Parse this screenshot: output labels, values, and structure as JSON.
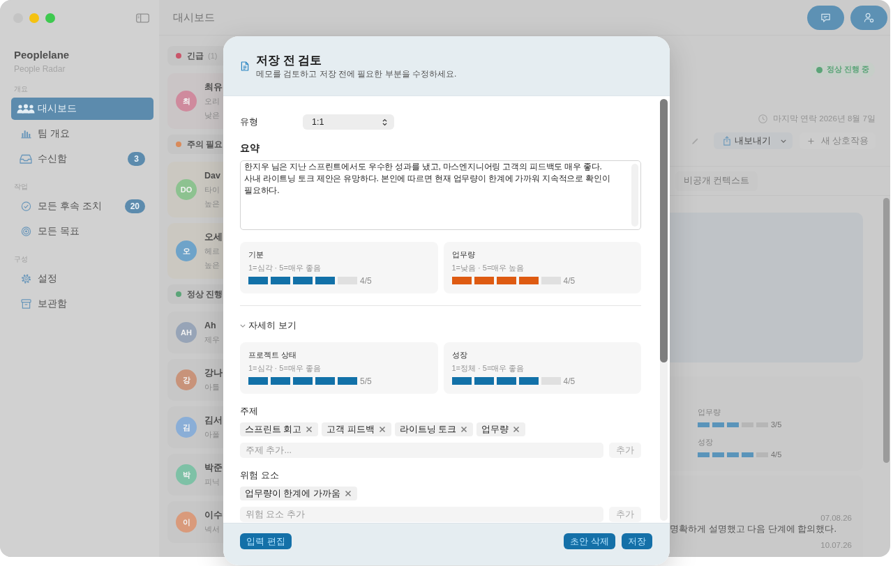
{
  "window": {
    "title": "대시보드",
    "close_button_disabled": true
  },
  "sidebar": {
    "app_name": "Peoplelane",
    "app_subtitle": "People Radar",
    "sections": [
      {
        "title": "개요",
        "items": [
          {
            "label": "대시보드",
            "selected": true
          },
          {
            "label": "팀 개요",
            "selected": false
          },
          {
            "label": "수신함",
            "badge": "3",
            "selected": false
          }
        ]
      },
      {
        "title": "작업",
        "items": [
          {
            "label": "모든 후속 조치",
            "badge": "20",
            "selected": false
          },
          {
            "label": "모든 목표",
            "selected": false
          }
        ]
      },
      {
        "title": "구성",
        "items": [
          {
            "label": "설정",
            "selected": false
          },
          {
            "label": "보관함",
            "selected": false
          }
        ]
      }
    ]
  },
  "people_list": {
    "groups": [
      {
        "title": "긴급",
        "count": "(1)",
        "color": "#c9566a",
        "people": [
          {
            "initials": "최",
            "color": "#cf8a9d",
            "name": "최유",
            "lines": [
              "오리",
              "낮은"
            ]
          }
        ]
      },
      {
        "title": "주의 필요",
        "color": "#d98b5b",
        "people": [
          {
            "initials": "DO",
            "color": "#8dc290",
            "name": "Dav",
            "lines": [
              "타이",
              "높은"
            ]
          },
          {
            "initials": "오",
            "color": "#6ea3c9",
            "name": "오세",
            "lines": [
              "헤르",
              "높은"
            ]
          }
        ]
      },
      {
        "title": "정상 진행",
        "color": "#5ba478",
        "people": [
          {
            "initials": "AH",
            "color": "#97a4b7",
            "name": "Ah",
            "lines": [
              "제우"
            ]
          },
          {
            "initials": "강",
            "color": "#c8937a",
            "name": "강나",
            "lines": [
              "아틀"
            ]
          },
          {
            "initials": "김",
            "color": "#8aaed7",
            "name": "김서",
            "lines": [
              "아폴"
            ]
          },
          {
            "initials": "박",
            "color": "#7ec1a6",
            "name": "박준",
            "lines": [
              "피닉"
            ]
          },
          {
            "initials": "이",
            "color": "#d99a7b",
            "name": "이수",
            "lines": [
              "넥서"
            ]
          }
        ]
      }
    ]
  },
  "detail": {
    "status": {
      "label": "정상 진행 중",
      "color": "#5ba478"
    },
    "last_contact": "마지막 연락 2026년 8월 7일",
    "toolbar": {
      "export_label": "내보내기",
      "new_label": "새 상호작용",
      "new_disabled": true
    },
    "tabs": [
      {
        "label": "비공개 컨텍스트",
        "selected": false
      }
    ],
    "ratings": [
      {
        "label": "업무량",
        "level": 0.6,
        "reading": "3/5"
      },
      {
        "label": "성장",
        "level": 0.8,
        "reading": "4/5"
      }
    ],
    "notes": [
      {
        "date": "07.08.26",
        "text": "명확하게 설명했고 다음 단계에 합의했다."
      },
      {
        "date": "10.07.26"
      }
    ]
  },
  "review_dialog": {
    "title": "저장 전 검토",
    "subtitle": "메모를 검토하고 저장 전에 필요한 부분을 수정하세요.",
    "type": {
      "label": "유형",
      "value": "1:1"
    },
    "summary": {
      "label": "요약",
      "value": "한지우 님은 지난 스프린트에서도 우수한 성과를 냈고, 마스엔지니어링 고객의 피드백도 매우 좋다. 사내 라이트닝 토크 제안은 유망하다. 본인에 따르면 현재 업무량이 한계에 가까워 지속적으로 확인이 필요하다."
    },
    "ratings": [
      {
        "label": "기분",
        "hint": "1=심각 · 5=매우 좋음",
        "level": 0.8,
        "reading": "4/5",
        "color": "#1271a8"
      },
      {
        "label": "업무량",
        "hint": "1=낮음 · 5=매우 높음",
        "level": 0.8,
        "reading": "4/5",
        "color": "#de5b12"
      }
    ],
    "details": {
      "label": "자세히 보기",
      "expanded": true,
      "ratings": [
        {
          "label": "프로젝트 상태",
          "hint": "1=심각 · 5=매우 좋음",
          "level": 1,
          "reading": "5/5",
          "color": "#1271a8"
        },
        {
          "label": "성장",
          "hint": "1=정체 · 5=매우 좋음",
          "level": 0.8,
          "reading": "4/5",
          "color": "#1271a8"
        }
      ]
    },
    "topics": {
      "label": "주제",
      "tags": [
        "스프린트 회고",
        "고객 피드백",
        "라이트닝 토크",
        "업무량"
      ],
      "placeholder": "주제 추가...",
      "add_button": {
        "label": "추가",
        "disabled": true
      }
    },
    "risks": {
      "label": "위험 요소",
      "tags": [
        "업무량이 한계에 가까움"
      ],
      "placeholder": "위험 요소 추가",
      "add_button": {
        "label": "추가",
        "disabled": true
      }
    },
    "footer": {
      "left_buttons": [
        "입력 편집"
      ],
      "right_buttons": [
        "초안 삭제",
        "저장"
      ]
    }
  }
}
